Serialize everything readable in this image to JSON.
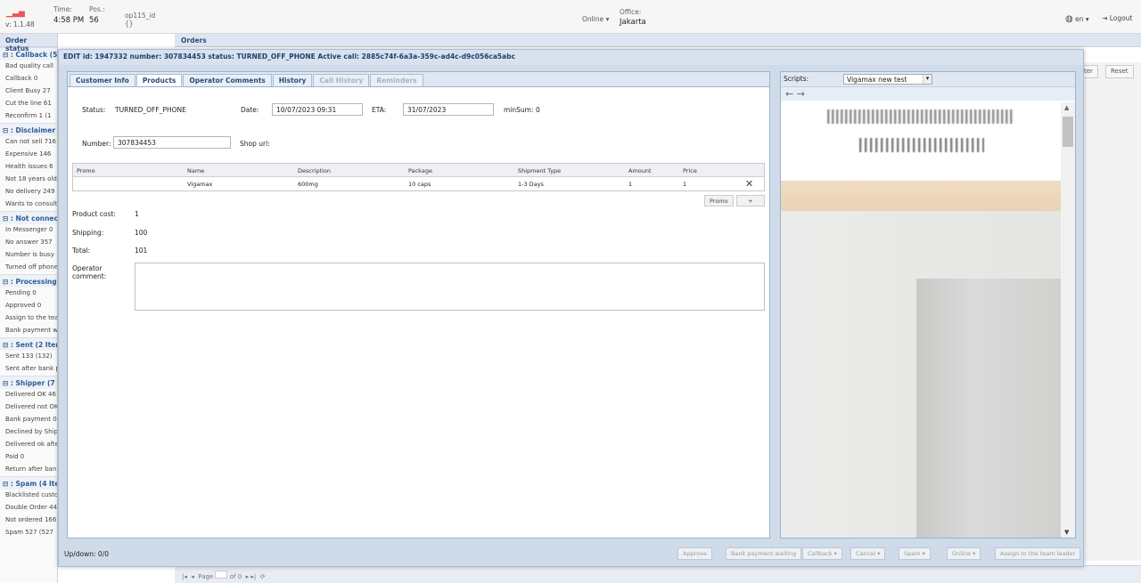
{
  "topbar": {
    "version": "v: 1.1.48",
    "time_label": "Time:",
    "time": "4:58 PM",
    "pos_label": "Pos.:",
    "pos": "56",
    "user_id": "op115_id",
    "user_sub": "{}",
    "status": "Online",
    "office_label": "Office:",
    "office": "Jakarta",
    "lang": "en",
    "logout": "Logout"
  },
  "left": {
    "header": "Order status",
    "groups": [
      {
        "title": "⊟ : Callback (5",
        "items": [
          "Bad quality call",
          "Callback  0",
          "Client Busy  27",
          "Cut the line  61",
          "Reconfirm  1  (1"
        ]
      },
      {
        "title": "⊟ : Disclaimer (",
        "items": [
          "Can not sell  716",
          "Expensive  146",
          "Health issues  6",
          "Not 18 years old",
          "No delivery  249",
          "Wants to consult"
        ]
      },
      {
        "title": "⊟ : Not connect",
        "items": [
          "In Messenger  0",
          "No answer  357",
          "Number is busy",
          "Turned off phone"
        ]
      },
      {
        "title": "⊟ : Processing (",
        "items": [
          "Pending  0",
          "Approved  0",
          "Assign to the team",
          "Bank payment wa"
        ]
      },
      {
        "title": "⊟ : Sent (2 Item",
        "items": [
          "Sent  133  (132)",
          "Sent after bank p"
        ]
      },
      {
        "title": "⊟ : Shipper (7 I",
        "items": [
          "Delivered OK  46",
          "Delivered not OK",
          "Bank payment  0",
          "Declined by Shipp",
          "Delivered ok after",
          "Paid  0",
          "Return after bank"
        ]
      },
      {
        "title": "⊟ : Spam (4 Ite",
        "items": [
          "Blacklisted custom",
          "Double Order  44",
          "Not ordered  166",
          "Spam  527  (527"
        ]
      }
    ]
  },
  "orders_header": "Orders",
  "bg": {
    "partial_btn": "ter",
    "reset": "Reset"
  },
  "pager": {
    "page_label": "Page",
    "of": "of 0"
  },
  "dialog": {
    "title": "EDIT id: 1947332 number: 307834453 status: TURNED_OFF_PHONE Active call: 2885c74f-6a3a-359c-ad4c-d9c056ca5abc",
    "tabs": [
      "Customer Info",
      "Products",
      "Operator Comments",
      "History",
      "Call History",
      "Reminders"
    ],
    "status_label": "Status:",
    "status": "TURNED_OFF_PHONE",
    "date_label": "Date:",
    "date": "10/07/2023 09:31",
    "eta_label": "ETA:",
    "eta": "31/07/2023",
    "minsum_label": "minSum:",
    "minsum": "0",
    "number_label": "Number:",
    "number": "307834453",
    "shop_label": "Shop url:",
    "grid": {
      "headers": [
        "Promo",
        "Name",
        "Description",
        "Package",
        "Shipment Type",
        "Amount",
        "Price"
      ],
      "row": {
        "promo": "",
        "name": "Vigamax",
        "description": "600mg",
        "package": "10 caps",
        "shipment": "1-3 Days",
        "amount": "1",
        "price": "1"
      }
    },
    "promo_btn": "Promo",
    "plus_btn": "+",
    "product_cost_label": "Product cost:",
    "product_cost": "1",
    "shipping_label": "Shipping:",
    "shipping": "100",
    "total_label": "Total:",
    "total": "101",
    "comment_label": "Operator comment:",
    "updown": "Up/down: 0/0",
    "buttons": [
      "Approve",
      "Bank payment waiting",
      "Callback",
      "Cancel",
      "Spam",
      "Online",
      "Assign to the team leader"
    ],
    "scripts_label": "Scripts:",
    "script_value": "Vigamax new test",
    "nav_back": "←",
    "nav_fwd": "→"
  }
}
